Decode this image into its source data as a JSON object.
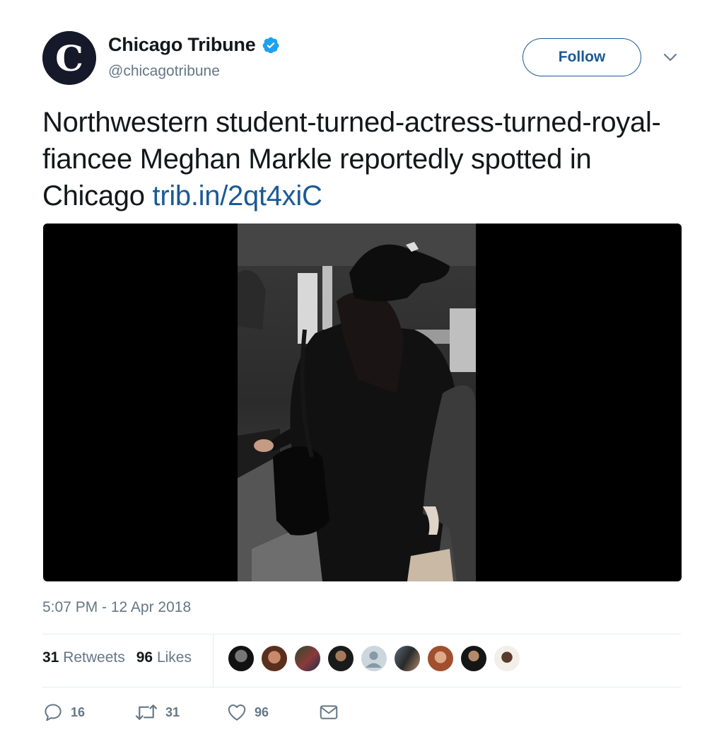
{
  "account": {
    "name": "Chicago Tribune",
    "handle": "@chicagotribune",
    "avatar_letter": "C",
    "verified": true,
    "follow_label": "Follow"
  },
  "tweet": {
    "text": "Northwestern student-turned-actress-turned-royal-fiancee Meghan Markle reportedly spotted in Chicago",
    "link": "trib.in/2qt4xiC",
    "timestamp": "5:07 PM - 12 Apr 2018"
  },
  "stats": {
    "retweets_count": "31",
    "retweets_label": "Retweets",
    "likes_count": "96",
    "likes_label": "Likes"
  },
  "actions": {
    "replies": "16",
    "retweets": "31",
    "likes": "96"
  },
  "colors": {
    "link": "#1b5a96",
    "secondary_text": "#657786",
    "verified": "#1da1f2",
    "divider": "#e6ecf0"
  },
  "icons": [
    "verified-badge-icon",
    "chevron-down-icon",
    "reply-icon",
    "retweet-icon",
    "like-icon",
    "direct-message-icon"
  ]
}
